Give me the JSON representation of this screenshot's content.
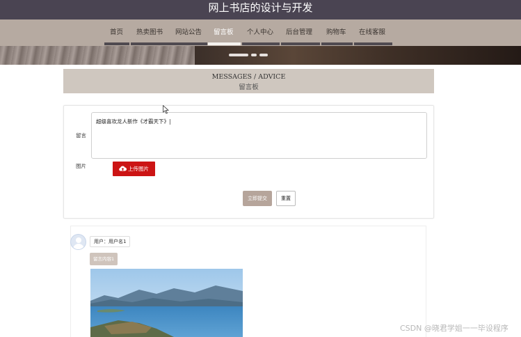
{
  "header": {
    "title": "网上书店的设计与开发"
  },
  "nav": {
    "items": [
      {
        "label": "首页"
      },
      {
        "label": "热卖图书"
      },
      {
        "label": "网站公告"
      },
      {
        "label": "留言板"
      },
      {
        "label": "个人中心"
      },
      {
        "label": "后台管理"
      },
      {
        "label": "购物车"
      },
      {
        "label": "在线客服"
      }
    ],
    "active_index": 3
  },
  "section": {
    "title_en": "MESSAGES / ADVICE",
    "title_cn": "留言板"
  },
  "form": {
    "message_label": "留言",
    "message_value": "超级喜欢龙人新作《才霸天下》",
    "image_label": "图片",
    "upload_label": "上传图片",
    "submit_label": "立即提交",
    "reset_label": "重置"
  },
  "comments": [
    {
      "user": "用户：用户名1",
      "content": "留言内容1"
    }
  ],
  "watermark": "CSDN @晓君学姐一一毕设程序",
  "colors": {
    "header": "#4a4452",
    "nav": "#b6aaa1",
    "accent_red": "#cc1414",
    "section": "#cfc7bf"
  }
}
